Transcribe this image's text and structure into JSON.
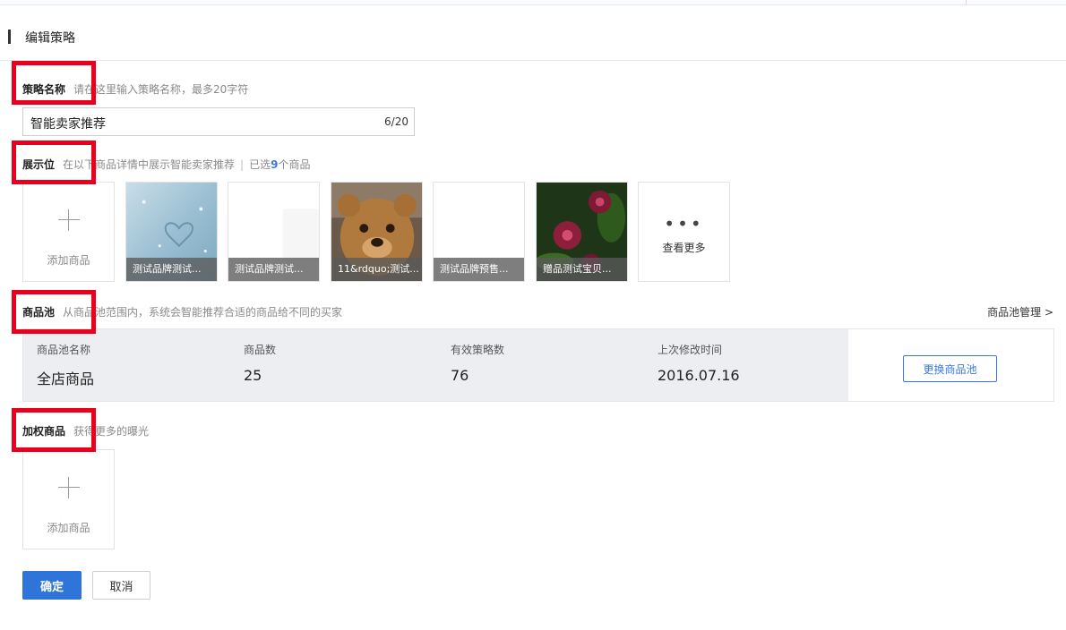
{
  "page": {
    "title": "编辑策略"
  },
  "strategy_name": {
    "label": "策略名称",
    "hint": "请在这里输入策略名称，最多20字符",
    "value": "智能卖家推荐",
    "counter": "6/20"
  },
  "display": {
    "label": "展示位",
    "hint": "在以下商品详情中展示智能卖家推荐",
    "selected_prefix": "已选",
    "selected_count": "9",
    "selected_suffix": "个商品",
    "add_label": "添加商品",
    "items": [
      {
        "caption": "测试品牌测试...",
        "icon": "snow-heart-image"
      },
      {
        "caption": "测试品牌测试...",
        "icon": "blank-image"
      },
      {
        "caption": "11&rdquo;测试...",
        "icon": "teddy-bear-image"
      },
      {
        "caption": "测试品牌预售...",
        "icon": "blank-image"
      },
      {
        "caption": "赠品测试宝贝...",
        "icon": "red-flower-image"
      }
    ],
    "more_label": "查看更多",
    "more_icon": "ellipsis-icon"
  },
  "pool": {
    "label": "商品池",
    "hint": "从商品池范围内，系统会智能推荐合适的商品给不同的买家",
    "manage_link": "商品池管理 >",
    "columns": [
      {
        "head": "商品池名称",
        "value": "全店商品"
      },
      {
        "head": "商品数",
        "value": "25"
      },
      {
        "head": "有效策略数",
        "value": "76"
      },
      {
        "head": "上次修改时间",
        "value": "2016.07.16"
      }
    ],
    "change_button": "更换商品池"
  },
  "weighted": {
    "label": "加权商品",
    "hint": "获得更多的曝光",
    "add_label": "添加商品"
  },
  "actions": {
    "confirm": "确定",
    "cancel": "取消"
  },
  "colors": {
    "accent": "#2f74d8",
    "highlight_box": "#e8001c",
    "panel_bg": "#eceef1"
  }
}
